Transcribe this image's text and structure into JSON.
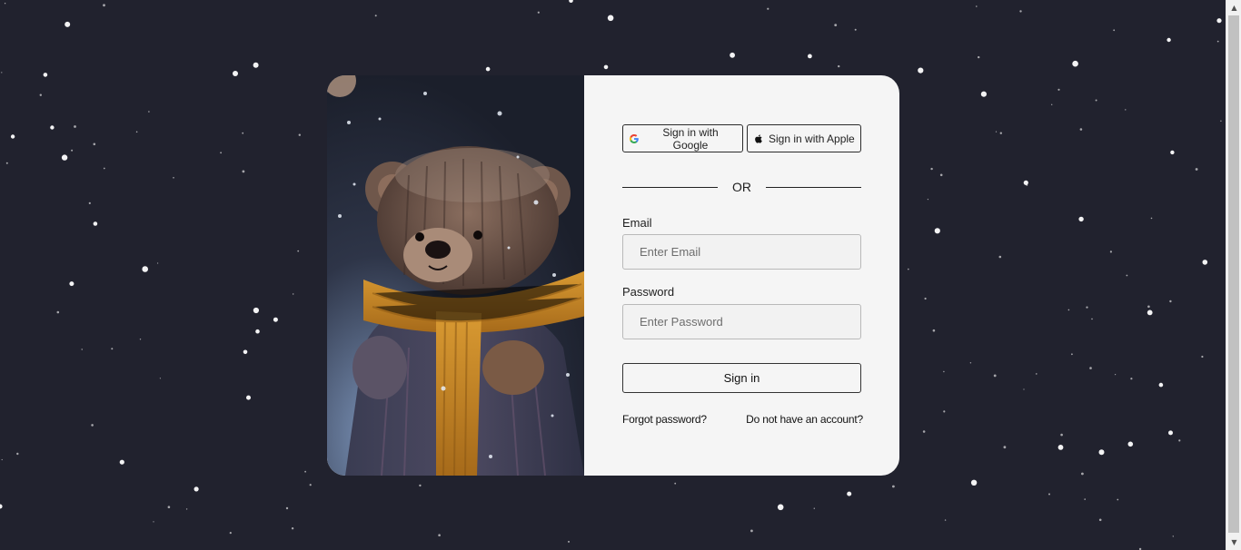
{
  "colors": {
    "background": "#21222e",
    "card": "#f5f5f5",
    "scarf": "#c98a2a",
    "bear_fur": "#6b5548",
    "snow": "#ffffff"
  },
  "auth": {
    "google_label": "Sign in with Google",
    "apple_label": "Sign in with Apple",
    "google_icon": "google-g-icon",
    "apple_icon": "apple-logo-icon",
    "divider_text": "OR",
    "email_label": "Email",
    "email_placeholder": "Enter Email",
    "email_value": "",
    "password_label": "Password",
    "password_placeholder": "Enter Password",
    "password_value": "",
    "submit_label": "Sign in",
    "forgot_label": "Forgot password?",
    "signup_label": "Do not have an account?"
  },
  "image": {
    "subject": "knitted teddy bear with scarf in snow"
  }
}
